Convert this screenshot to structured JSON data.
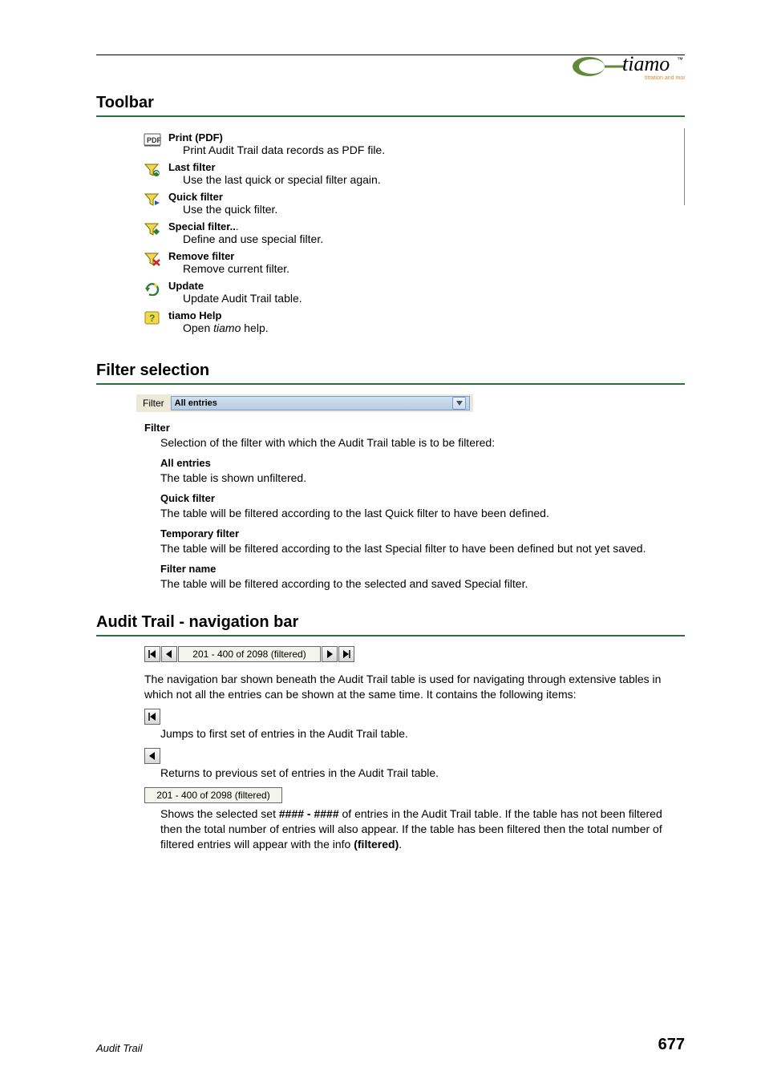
{
  "brand": {
    "name": "tiamo",
    "tagline": "titration and more"
  },
  "sections": {
    "toolbar": {
      "title": "Toolbar",
      "items": [
        {
          "title": "Print (PDF)",
          "desc": "Print Audit Trail data records as PDF file."
        },
        {
          "title": "Last filter",
          "desc": "Use the last quick or special filter again."
        },
        {
          "title": "Quick filter",
          "desc": "Use the quick filter."
        },
        {
          "title": "Special filter..",
          "dots": ".",
          "desc": "Define and use special filter."
        },
        {
          "title": "Remove filter",
          "desc": "Remove current filter."
        },
        {
          "title": "Update",
          "desc": "Update Audit Trail table."
        },
        {
          "title": "tiamo Help",
          "desc_prefix": "Open ",
          "desc_em": "tiamo",
          "desc_suffix": " help."
        }
      ]
    },
    "filter": {
      "title": "Filter selection",
      "label": "Filter",
      "selected": "All entries",
      "heading": "Filter",
      "intro": "Selection of the filter with which the Audit Trail table is to be filtered:",
      "all_entries_title": "All entries",
      "all_entries_desc": "The table is shown unfiltered.",
      "quick_title": "Quick filter",
      "quick_desc": "The table will be filtered according to the last Quick filter to have been defined.",
      "temp_title": "Temporary filter",
      "temp_desc": "The table will be filtered according to the last Special filter to have been defined but not yet saved.",
      "name_title": "Filter name",
      "name_desc": "The table will be filtered according to the selected and saved Special filter."
    },
    "nav": {
      "title": "Audit Trail - navigation bar",
      "range_text": "201 - 400 of 2098  (filtered)",
      "intro": "The navigation bar shown beneath the Audit Trail table is used for navigating through extensive tables in which not all the entries can be shown at the same time. It contains the following items:",
      "first_desc": "Jumps to first set of entries in the Audit Trail table.",
      "prev_desc": "Returns to previous set of entries in the Audit Trail table.",
      "range_desc_pre": "Shows the selected set ",
      "range_desc_bold": "#### - ####",
      "range_desc_mid": " of entries in the Audit Trail table. If the table has not been filtered then the total number of entries will also appear. If the table has been filtered then the total number of filtered entries will appear with the info ",
      "range_desc_bold2": "(filtered)",
      "range_desc_end": "."
    }
  },
  "footer": {
    "section": "Audit Trail",
    "page": "677"
  }
}
